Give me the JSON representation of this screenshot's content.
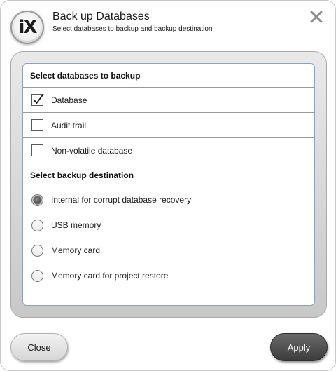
{
  "window": {
    "title": "Back up Databases",
    "subtitle": "Select databases to backup and backup destination",
    "logo_text": "iX",
    "logo_icon": "ix-logo-icon",
    "close_icon": "close-icon"
  },
  "databases_section": {
    "header": "Select databases to backup",
    "items": [
      {
        "label": "Database",
        "checked": true
      },
      {
        "label": "Audit trail",
        "checked": false
      },
      {
        "label": "Non-volatile database",
        "checked": false
      }
    ]
  },
  "destination_section": {
    "header": "Select backup destination",
    "options": [
      {
        "label": "Internal for corrupt database recovery",
        "selected": true
      },
      {
        "label": "USB memory",
        "selected": false
      },
      {
        "label": "Memory card",
        "selected": false
      },
      {
        "label": "Memory card for project restore",
        "selected": false
      }
    ]
  },
  "footer": {
    "close_label": "Close",
    "apply_label": "Apply"
  },
  "colors": {
    "panel_border": "#8fa3b8",
    "apply_bg": "#4a4a4a",
    "close_bg": "#e4e4e4",
    "logo_accent": "#d2232a"
  }
}
